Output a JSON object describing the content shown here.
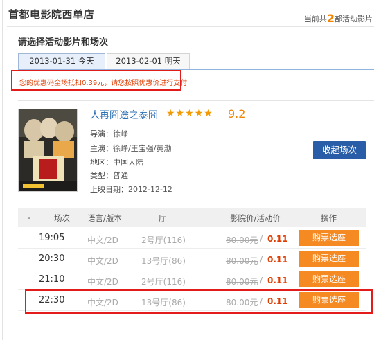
{
  "header": {
    "cinema_name": "首都电影院西单店",
    "active_prefix": "当前共",
    "active_count": "2",
    "active_suffix": "部活动影片"
  },
  "section_title": "请选择活动影片和场次",
  "tabs": [
    {
      "label": "2013-01-31 今天",
      "selected": true
    },
    {
      "label": "2013-02-01 明天",
      "selected": false
    }
  ],
  "notice": "您的优惠码全场抵扣0.39元，请您按照优惠价进行支付",
  "movie": {
    "title": "人再囧途之泰囧",
    "stars": "★★★★★",
    "rating": "9.2",
    "info": [
      {
        "key": "导演：",
        "value": "徐峥"
      },
      {
        "key": "主演：",
        "value": "徐峥/王宝强/黄渤"
      },
      {
        "key": "地区：",
        "value": "中国大陆"
      },
      {
        "key": "类型：",
        "value": "普通"
      },
      {
        "key": "上映日期：",
        "value": "2012-12-12"
      }
    ],
    "collapse_label": "收起场次"
  },
  "table": {
    "headers": {
      "dash": "-",
      "time": "场次",
      "lang": "语言/版本",
      "hall": "厅",
      "price": "影院价/活动价",
      "op": "操作"
    },
    "rows": [
      {
        "time": "19:05",
        "lang": "中文/2D",
        "hall": "2号厅(116)",
        "price": "80.00元",
        "slash": "/",
        "act": "0.11",
        "btn": "购票选座"
      },
      {
        "time": "20:30",
        "lang": "中文/2D",
        "hall": "13号厅(86)",
        "price": "80.00元",
        "slash": "/",
        "act": "0.11",
        "btn": "购票选座"
      },
      {
        "time": "21:10",
        "lang": "中文/2D",
        "hall": "2号厅(116)",
        "price": "80.00元",
        "slash": "/",
        "act": "0.11",
        "btn": "购票选座"
      },
      {
        "time": "22:30",
        "lang": "中文/2D",
        "hall": "13号厅(86)",
        "price": "80.00元",
        "slash": "/",
        "act": "0.11",
        "btn": "购票选座"
      }
    ]
  },
  "colors": {
    "accent_orange": "#f58a23",
    "highlight_red": "#e31b1b",
    "link_blue": "#2a6fb5",
    "button_blue": "#2a5da8"
  }
}
